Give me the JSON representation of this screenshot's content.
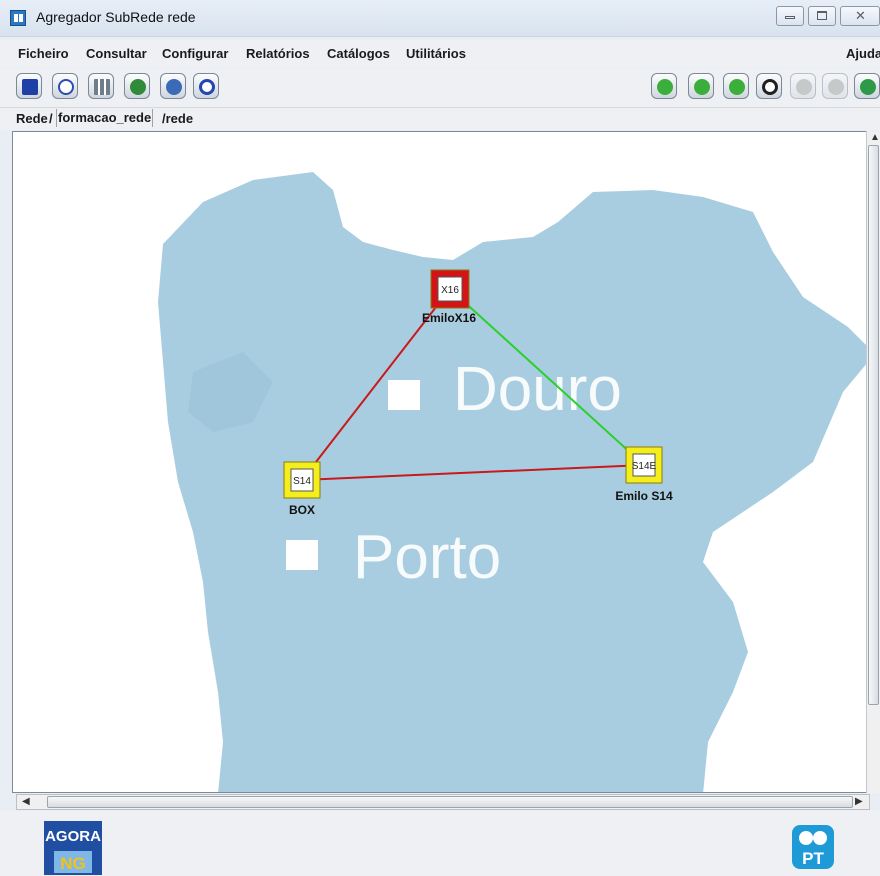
{
  "window": {
    "title": "Agregador SubRede  rede"
  },
  "menu": [
    "Ficheiro",
    "Consultar",
    "Configurar",
    "Relatórios",
    "Catálogos",
    "Utilitários"
  ],
  "menu_right": "Ajuda",
  "toolbar_left": [
    "save-icon",
    "clock-icon",
    "network-icon",
    "globe-icon",
    "route-icon",
    "search-icon"
  ],
  "toolbar_right": [
    "stop-icon",
    "previous-icon",
    "next-icon",
    "up-icon",
    "zoom-in-icon",
    "zoom-out-icon",
    "tree-icon"
  ],
  "breadcrumb": {
    "root": "Rede",
    "separator": "/",
    "middle": "formacao_rede",
    "tail": "/rede"
  },
  "map": {
    "regions": [
      "Douro",
      "Porto"
    ],
    "nodes": [
      {
        "id": "emilox16",
        "tag": "X16",
        "label": "EmiloX16",
        "status_color": "#d41414"
      },
      {
        "id": "box",
        "tag": "S14",
        "label": "BOX",
        "status_color": "#f4ee1c"
      },
      {
        "id": "emilos14",
        "tag": "S14E",
        "label": "Emilo S14",
        "status_color": "#f4ee1c"
      }
    ],
    "links": [
      {
        "from": "emilox16",
        "to": "box",
        "color": "#c81a1a"
      },
      {
        "from": "emilox16",
        "to": "emilos14",
        "color": "#2ad12a"
      },
      {
        "from": "box",
        "to": "emilos14",
        "color": "#c81a1a"
      }
    ]
  },
  "footer": {
    "left_logo": {
      "line1": "AGORA",
      "line2": "NG"
    },
    "right_logo": {
      "text": "PT"
    }
  },
  "colors": {
    "land": "#a9cde0",
    "sea": "#ffffff"
  }
}
